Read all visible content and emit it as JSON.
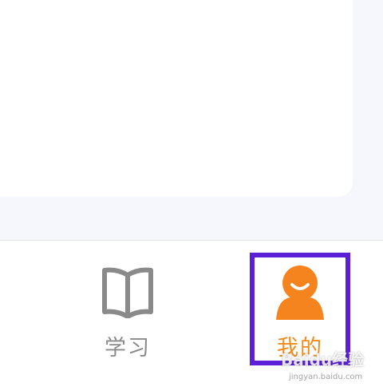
{
  "tabs": [
    {
      "label": "学习",
      "icon": "book-icon",
      "color": "#8a8a8a"
    },
    {
      "label": "我的",
      "icon": "person-icon",
      "color": "#f08a1c"
    }
  ],
  "highlight_color": "#5a1fd6",
  "watermark": {
    "text": "Baidu经验",
    "url": "jingyan.baidu.com"
  }
}
